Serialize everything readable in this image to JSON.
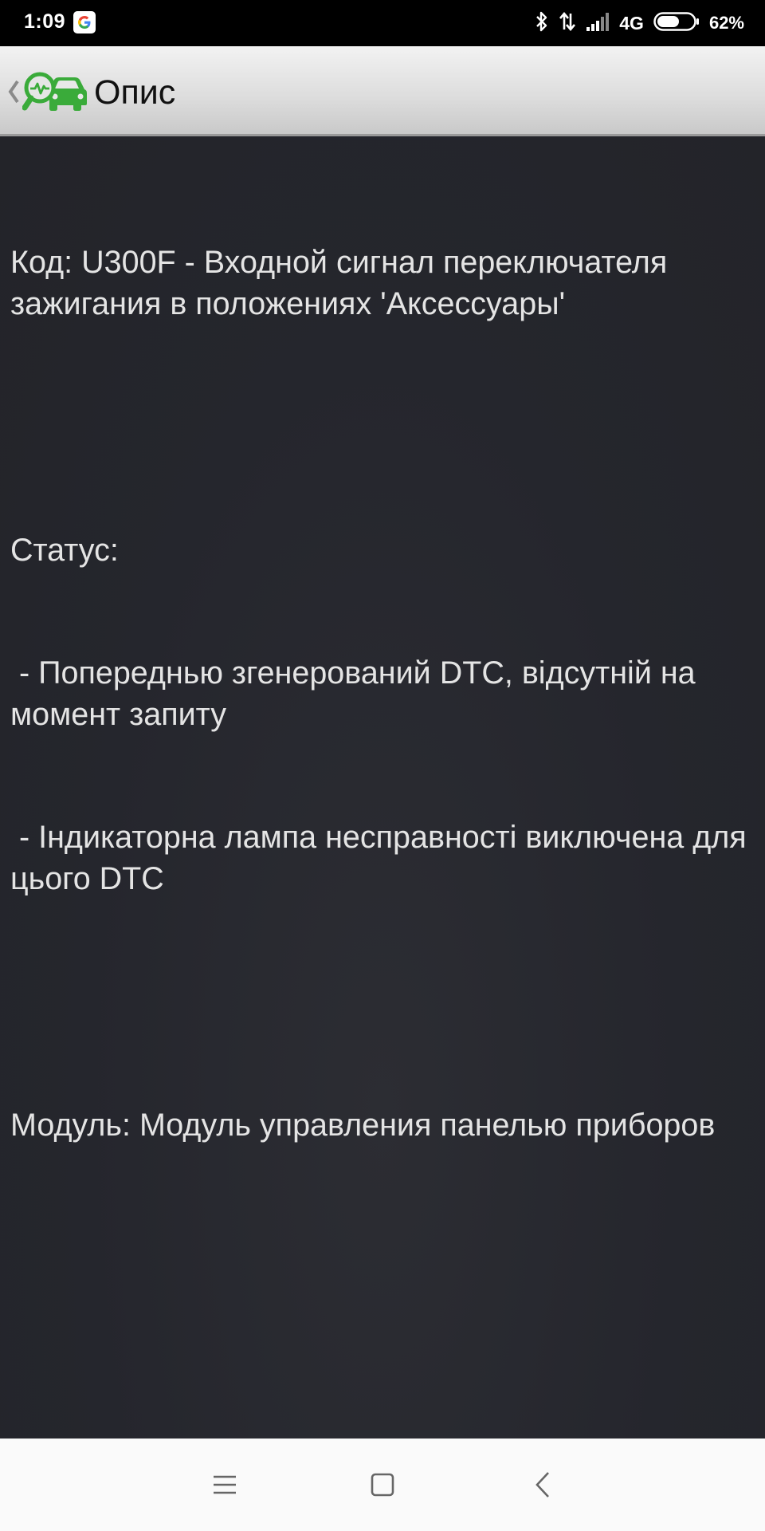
{
  "status_bar": {
    "time": "1:09",
    "network": "4G",
    "battery_percent": "62%",
    "battery_level": 0.62,
    "icons": [
      "google-icon",
      "bluetooth-icon",
      "data-arrows-icon",
      "signal-icon",
      "battery-icon"
    ]
  },
  "toolbar": {
    "title": "Опис",
    "logo": "car-diagnostic-logo-icon",
    "back": "back-chevron-icon"
  },
  "content": {
    "code_line": "Код: U300F - Входной сигнал переключателя зажигания в положениях 'Аксессуары'",
    "status_label": "Статус:",
    "status_items": [
      " - Попереднью згенерований DTC, відсутній на момент запиту",
      " - Індикаторна лампа несправності виключена для цього DTC"
    ],
    "module_line": "Модуль: Модуль управления панелью приборов"
  },
  "nav_bar": {
    "buttons": [
      "menu-icon",
      "home-icon",
      "back-icon"
    ]
  },
  "colors": {
    "content_background": "#25262d",
    "content_text": "#e4e4e4",
    "logo_green": "#3aab3a",
    "toolbar_background": "#dcdcdc",
    "nav_background": "#fafafa"
  }
}
